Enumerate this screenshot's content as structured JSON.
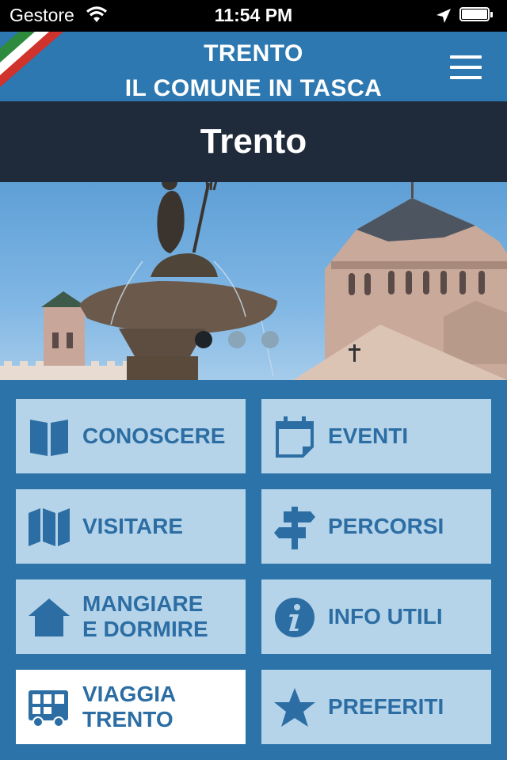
{
  "status_bar": {
    "carrier": "Gestore",
    "time": "11:54 PM"
  },
  "header": {
    "title_line1": "TRENTO",
    "title_line2": "IL COMUNE IN TASCA",
    "flag_colors": [
      "#2e8b3e",
      "#ffffff",
      "#d0322c"
    ]
  },
  "city": {
    "name": "Trento"
  },
  "carousel": {
    "slide_count": 3,
    "active_index": 0
  },
  "tiles": [
    {
      "label_line1": "CONOSCERE",
      "label_line2": "",
      "icon": "book-icon",
      "active": false
    },
    {
      "label_line1": "EVENTI",
      "label_line2": "",
      "icon": "calendar-icon",
      "active": false
    },
    {
      "label_line1": "VISITARE",
      "label_line2": "",
      "icon": "map-icon",
      "active": false
    },
    {
      "label_line1": "PERCORSI",
      "label_line2": "",
      "icon": "signpost-icon",
      "active": false
    },
    {
      "label_line1": "MANGIARE",
      "label_line2": "E DORMIRE",
      "icon": "house-icon",
      "active": false
    },
    {
      "label_line1": "INFO UTILI",
      "label_line2": "",
      "icon": "info-icon",
      "active": false
    },
    {
      "label_line1": "VIAGGIA",
      "label_line2": "TRENTO",
      "icon": "bus-icon",
      "active": true
    },
    {
      "label_line1": "PREFERITI",
      "label_line2": "",
      "icon": "star-icon",
      "active": false
    }
  ],
  "colors": {
    "primary": "#2b73a8",
    "tile_bg": "#b6d4e9",
    "tile_active_bg": "#ffffff",
    "tile_text": "#2c6ea4",
    "city_band": "#1f2a3a"
  }
}
